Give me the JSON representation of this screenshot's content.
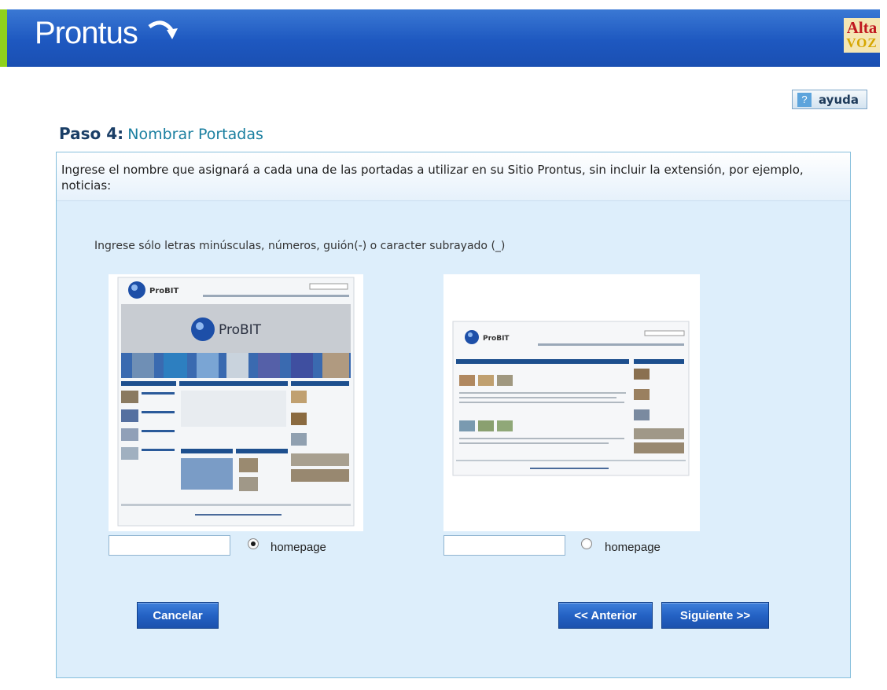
{
  "header": {
    "logo_text": "Prontus",
    "brand_line1": "Alta",
    "brand_line2": "VOZ"
  },
  "help": {
    "label": "ayuda",
    "icon": "?"
  },
  "step": {
    "number_label": "Paso 4:",
    "name": "Nombrar Portadas"
  },
  "intro": "Ingrese el nombre que asignará a cada una de las portadas a utilizar en su Sitio Prontus, sin incluir la extensión, por ejemplo, noticias:",
  "hint": "Ingrese sólo letras minúsculas, números, guión(-) o caracter subrayado (_)",
  "portadas": [
    {
      "name_value": "",
      "radio_label": "homepage",
      "selected": true
    },
    {
      "name_value": "",
      "radio_label": "homepage",
      "selected": false
    }
  ],
  "thumb_brand": "ProBIT",
  "buttons": {
    "cancel": "Cancelar",
    "previous": "<< Anterior",
    "next": "Siguiente >>"
  },
  "colors": {
    "header_blue": "#1e58c0",
    "accent_green": "#8fd11d",
    "title_dark": "#1a3e66",
    "title_teal": "#1a7fa0"
  }
}
